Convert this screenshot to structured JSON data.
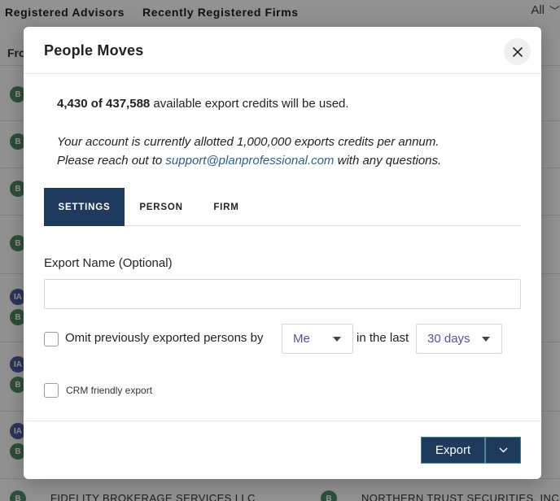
{
  "background": {
    "tabs": [
      "Registered Advisors",
      "Recently Registered Firms"
    ],
    "filter_value": "All",
    "column_header": "Fro",
    "badges": [
      "B",
      "B",
      "B",
      "B",
      "IA",
      "B",
      "IA",
      "B",
      "IA",
      "B",
      "B",
      "B"
    ],
    "bottom_row": {
      "left_text": "FIDELITY BROKERAGE SERVICES LLC",
      "right_text": "NORTHERN TRUST SECURITIES, INC."
    }
  },
  "modal": {
    "title": "People Moves",
    "credits": {
      "count_bold": "4,430 of 437,588",
      "suffix": " available export credits will be used."
    },
    "allotment_text": "Your account is currently allotted 1,000,000 exports credits per annum.",
    "contact": {
      "prefix": "Please reach out to ",
      "email": "support@planprofessional.com",
      "suffix": " with any questions."
    },
    "tabs": [
      "SETTINGS",
      "PERSON",
      "FIRM"
    ],
    "active_tab": "SETTINGS",
    "export_name": {
      "label": "Export Name (Optional)",
      "value": "",
      "placeholder": ""
    },
    "omit": {
      "label": "Omit previously exported persons by",
      "by_value": "Me",
      "in_last_label": "in the last",
      "period_value": "30 days",
      "checked": false
    },
    "crm": {
      "label": "CRM friendly export",
      "checked": false
    },
    "footer": {
      "export_label": "Export"
    }
  },
  "colors": {
    "primary": "#1e3a5c",
    "link": "#2e5f8c",
    "select_text": "#5a4f9e",
    "badge_b": "#4f8a63",
    "badge_ia": "#4d5c9d"
  }
}
